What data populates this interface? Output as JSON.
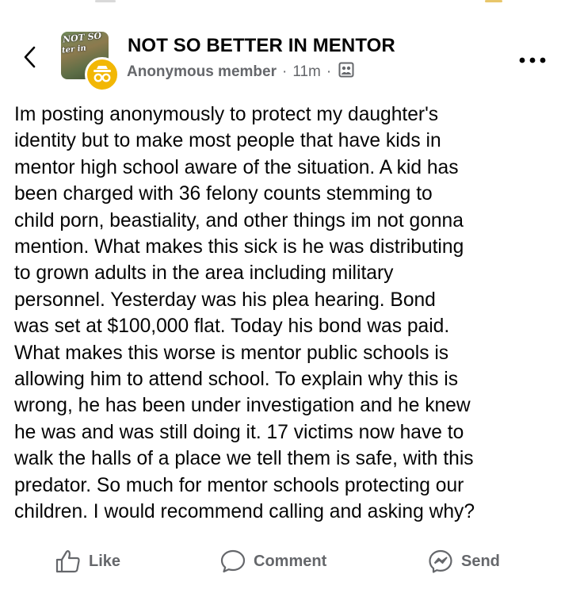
{
  "header": {
    "group_name": "NOT SO BETTER IN MENTOR",
    "author": "Anonymous member",
    "separator": "·",
    "time_ago": "11m",
    "separator2": "·",
    "avatar_text_line1": "NOT SO",
    "avatar_text_line2": "ter in"
  },
  "post": {
    "text": "Im posting anonymously to protect my daughter's\nidentity but to make most people that have kids in\nmentor high school aware of the situation. A kid has\nbeen charged with 36 felony counts stemming to\nchild porn, beastiality, and other things im not gonna\nmention.  What makes this sick is he was distributing\nto grown adults in the area including military\npersonnel.  Yesterday was his plea hearing. Bond\nwas set at $100,000 flat. Today his bond was paid.\nWhat makes this worse is mentor public schools is\nallowing him to attend school.  To explain why this is\nwrong, he has been under investigation and he knew\nhe was and was still doing it. 17 victims now have to\nwalk the halls of a place we tell them is safe, with this\npredator. So much for mentor schools protecting our\nchildren. I would recommend calling and asking why?"
  },
  "actions": {
    "like": "Like",
    "comment": "Comment",
    "send": "Send"
  },
  "icons": {
    "back": "chevron-left-icon",
    "more": "more-horizontal-icon",
    "privacy": "group-privacy-icon",
    "like": "thumbs-up-icon",
    "comment": "speech-bubble-icon",
    "send": "messenger-icon",
    "anon": "anonymous-incognito-icon"
  },
  "colors": {
    "text": "#050505",
    "secondary": "#65676b",
    "anon_badge": "#f2b705"
  }
}
